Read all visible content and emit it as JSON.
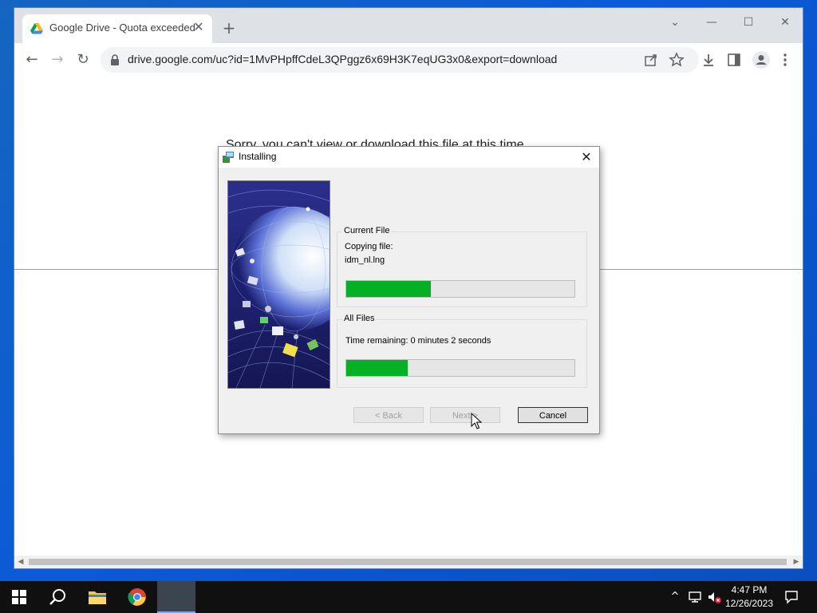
{
  "browser": {
    "tab": {
      "title": "Google Drive - Quota exceeded",
      "close": "✕"
    },
    "new_tab": "+",
    "window_controls": {
      "tabsearch": "⌄",
      "minimize": "—",
      "maximize": "☐",
      "close": "✕"
    },
    "nav": {
      "back": "←",
      "forward": "→",
      "reload": "↻"
    },
    "url": "drive.google.com/uc?id=1MvPHpffCdeL3QPggz6x69H3K7eqUG3x0&export=download",
    "toolbar_icons": [
      "share-icon",
      "star-icon",
      "download-icon",
      "side-panel-icon",
      "profile-icon",
      "menu-icon"
    ],
    "page": {
      "message": "Sorry, you can't view or download this file at this time."
    }
  },
  "dialog": {
    "title": "Installing",
    "close": "✕",
    "current_file": {
      "legend": "Current File",
      "label": "Copying file:",
      "filename": "idm_nl.lng",
      "progress": 0.37
    },
    "all_files": {
      "legend": "All Files",
      "time_remaining": "Time remaining: 0 minutes 2 seconds",
      "progress": 0.27
    },
    "buttons": {
      "back": "< Back",
      "next": "Next >",
      "cancel": "Cancel"
    }
  },
  "taskbar": {
    "time": "4:47 PM",
    "date": "12/26/2023"
  },
  "colors": {
    "progress_fill": "#06b025",
    "desktop": "#0b5ad8",
    "taskbar": "#101010"
  }
}
